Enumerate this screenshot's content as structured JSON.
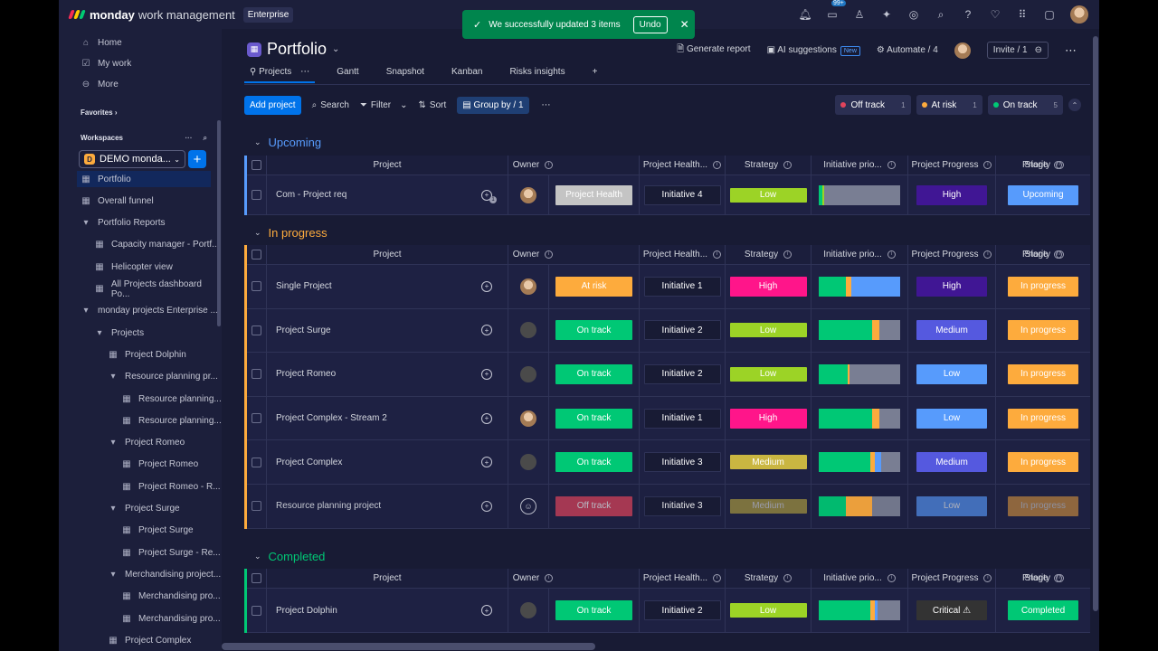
{
  "topbar": {
    "brand": "monday",
    "brand_sub": "work management",
    "plan": "Enterprise",
    "notif_badge": "99+"
  },
  "toast": {
    "message": "We successfully updated 3 items",
    "undo": "Undo"
  },
  "sidebar": {
    "top": [
      {
        "label": "Home",
        "icon": "home-icon"
      },
      {
        "label": "My work",
        "icon": "checkbox-icon"
      },
      {
        "label": "More",
        "icon": "more-icon"
      }
    ],
    "favorites": "Favorites",
    "workspaces": "Workspaces",
    "workspace_name": "DEMO monda...",
    "workspace_letter": "D",
    "tree": [
      {
        "label": "Portfolio",
        "indent": 0,
        "active": true
      },
      {
        "label": "Overall funnel",
        "indent": 0
      },
      {
        "label": "Portfolio Reports",
        "indent": 0,
        "folder": true
      },
      {
        "label": "Capacity manager - Portf...",
        "indent": 1
      },
      {
        "label": "Helicopter view",
        "indent": 1
      },
      {
        "label": "All Projects dashboard Po...",
        "indent": 1
      },
      {
        "label": "monday projects Enterprise ...",
        "indent": 0,
        "folder": true
      },
      {
        "label": "Projects",
        "indent": 1,
        "folder": true
      },
      {
        "label": "Project Dolphin",
        "indent": 2
      },
      {
        "label": "Resource planning pr...",
        "indent": 2,
        "folder": true
      },
      {
        "label": "Resource planning...",
        "indent": 3
      },
      {
        "label": "Resource planning...",
        "indent": 3
      },
      {
        "label": "Project Romeo",
        "indent": 2,
        "folder": true
      },
      {
        "label": "Project Romeo",
        "indent": 3
      },
      {
        "label": "Project Romeo - R...",
        "indent": 3
      },
      {
        "label": "Project Surge",
        "indent": 2,
        "folder": true
      },
      {
        "label": "Project Surge",
        "indent": 3
      },
      {
        "label": "Project Surge - Re...",
        "indent": 3
      },
      {
        "label": "Merchandising project...",
        "indent": 2,
        "folder": true
      },
      {
        "label": "Merchandising pro...",
        "indent": 3
      },
      {
        "label": "Merchandising pro...",
        "indent": 3
      },
      {
        "label": "Project Complex",
        "indent": 2
      }
    ]
  },
  "board": {
    "title": "Portfolio",
    "actions": {
      "generate": "Generate report",
      "ai": "AI suggestions",
      "ai_new": "New",
      "automate": "Automate / 4",
      "invite": "Invite / 1"
    },
    "tabs": [
      "Projects",
      "Gantt",
      "Snapshot",
      "Kanban",
      "Risks insights"
    ],
    "toolbar": {
      "add": "Add project",
      "search": "Search",
      "filter": "Filter",
      "sort": "Sort",
      "group": "Group by / 1"
    },
    "status_pills": [
      {
        "label": "Off track",
        "count": "1",
        "color": "#e2445c"
      },
      {
        "label": "At risk",
        "count": "1",
        "color": "#fdab3d"
      },
      {
        "label": "On track",
        "count": "5",
        "color": "#00c875"
      }
    ],
    "columns": [
      "Project",
      "Owner",
      "Project Health...",
      "Strategy",
      "Initiative prio...",
      "Project Progress",
      "Priority",
      "Stage"
    ]
  },
  "groups": [
    {
      "title": "Upcoming",
      "color": "#579bfc",
      "rows": [
        {
          "name": "Com - Project req",
          "owner": "photo",
          "health": "Project Health",
          "healthColor": "#c4c4c4",
          "strategy": "Initiative 4",
          "prio": "Low",
          "prioColor": "#cab641",
          "progress": [
            [
              "#00c875",
              0.04
            ],
            [
              "#9cd326",
              0.03
            ],
            [
              "#797e93",
              0.93
            ]
          ],
          "priority": "High",
          "priorityColor": "#401694",
          "stage": "Upcoming",
          "stageColor": "#579bfc",
          "chatBadge": "1"
        }
      ]
    },
    {
      "title": "In progress",
      "color": "#fdab3d",
      "rows": [
        {
          "name": "Single Project",
          "owner": "photo",
          "health": "At risk",
          "healthColor": "#fdab3d",
          "strategy": "Initiative 1",
          "prio": "High",
          "prioColor": "#ff158a",
          "progress": [
            [
              "#00c875",
              0.33
            ],
            [
              "#fdab3d",
              0.07
            ],
            [
              "#579bfc",
              0.6
            ]
          ],
          "priority": "High",
          "priorityColor": "#401694",
          "stage": "In progress",
          "stageColor": "#fdab3d"
        },
        {
          "name": "Project Surge",
          "owner": "dark",
          "health": "On track",
          "healthColor": "#00c875",
          "strategy": "Initiative 2",
          "prio": "Low",
          "prioColor": "#cab641",
          "progress": [
            [
              "#00c875",
              0.66
            ],
            [
              "#fdab3d",
              0.08
            ],
            [
              "#797e93",
              0.26
            ]
          ],
          "priority": "Medium",
          "priorityColor": "#5559df",
          "stage": "In progress",
          "stageColor": "#fdab3d"
        },
        {
          "name": "Project Romeo",
          "owner": "dark",
          "health": "On track",
          "healthColor": "#00c875",
          "strategy": "Initiative 2",
          "prio": "Low",
          "prioColor": "#cab641",
          "progress": [
            [
              "#00c875",
              0.36
            ],
            [
              "#fdab3d",
              0.02
            ],
            [
              "#797e93",
              0.62
            ]
          ],
          "priority": "Low",
          "priorityColor": "#579bfc",
          "stage": "In progress",
          "stageColor": "#fdab3d"
        },
        {
          "name": "Project Complex - Stream 2",
          "owner": "photo",
          "health": "On track",
          "healthColor": "#00c875",
          "strategy": "Initiative 1",
          "prio": "High",
          "prioColor": "#ff158a",
          "progress": [
            [
              "#00c875",
              0.66
            ],
            [
              "#fdab3d",
              0.08
            ],
            [
              "#797e93",
              0.26
            ]
          ],
          "priority": "Low",
          "priorityColor": "#579bfc",
          "stage": "In progress",
          "stageColor": "#fdab3d"
        },
        {
          "name": "Project Complex",
          "owner": "dark",
          "health": "On track",
          "healthColor": "#00c875",
          "strategy": "Initiative 3",
          "prio": "Medium",
          "prioColor": "#cab641",
          "progress": [
            [
              "#00c875",
              0.63
            ],
            [
              "#fdab3d",
              0.06
            ],
            [
              "#579bfc",
              0.08
            ],
            [
              "#797e93",
              0.23
            ]
          ],
          "priority": "Medium",
          "priorityColor": "#5559df",
          "stage": "In progress",
          "stageColor": "#fdab3d"
        },
        {
          "name": "Resource planning project",
          "owner": "empty",
          "health": "Off track",
          "healthColor": "#e2445c",
          "strategy": "Initiative 3",
          "prio": "Medium",
          "prioColor": "#cab641",
          "progress": [
            [
              "#00c875",
              0.33
            ],
            [
              "#fdab3d",
              0.33
            ],
            [
              "#797e93",
              0.34
            ]
          ],
          "priority": "Low",
          "priorityColor": "#579bfc",
          "stage": "In progress",
          "stageColor": "#fdab3d",
          "dim": true
        }
      ]
    },
    {
      "title": "Completed",
      "color": "#00c875",
      "rows": [
        {
          "name": "Project Dolphin",
          "owner": "dark",
          "health": "On track",
          "healthColor": "#00c875",
          "strategy": "Initiative 2",
          "prio": "Low",
          "prioColor": "#cab641",
          "progress": [
            [
              "#00c875",
              0.63
            ],
            [
              "#fdab3d",
              0.06
            ],
            [
              "#579bfc",
              0.03
            ],
            [
              "#797e93",
              0.28
            ]
          ],
          "priority": "Critical ⚠",
          "priorityColor": "#333333",
          "stage": "Completed",
          "stageColor": "#00c875"
        }
      ]
    }
  ]
}
